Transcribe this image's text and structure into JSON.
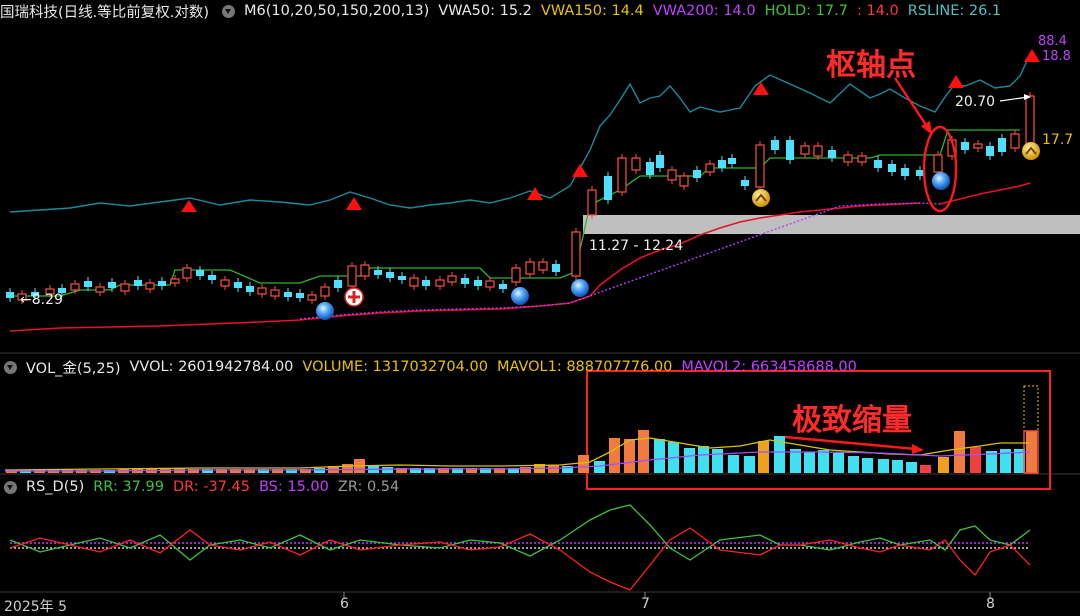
{
  "header": {
    "title": "国瑞科技(日线.等比前复权.对数)",
    "ma_label": "M6(10,20,50,150,200,13)",
    "vwa50": "VWA50: 15.2",
    "vwa150": "VWA150: 14.4",
    "vwa200": "VWA200: 14.0",
    "hold": "HOLD: 17.7",
    "hold_extra": ": 14.0",
    "rsline": "RSLINE: 26.1"
  },
  "price_panel": {
    "price_low_label": "←8.29",
    "range_label": "11.27 - 12.24",
    "high_label": "20.70",
    "hold_right": "17.7",
    "rs_right_top": "88.4",
    "rs_right_bottom": "18.8",
    "annotation_pivot": "枢轴点"
  },
  "volume_panel": {
    "name": "VOL_金(5,25)",
    "vvol": "VVOL: 2601942784.00",
    "volume": "VOLUME: 1317032704.00",
    "mavol1": "MAVOL1: 888707776.00",
    "mavol2": "MAVOL2: 663458688.00",
    "annotation_shrink": "极致缩量"
  },
  "rs_panel": {
    "name": "RS_D(5)",
    "rr": "RR: 37.99",
    "dr": "DR: -37.45",
    "bs": "BS: 15.00",
    "zr": "ZR: 0.54"
  },
  "x_axis": {
    "labels": [
      "2025年 5",
      "6",
      "7",
      "8"
    ]
  },
  "colors": {
    "up": "#ff5040",
    "down": "#50e0ff",
    "rsline": "#1a8a9a",
    "hold_line": "#2fb52f",
    "ma_red": "#e8102a",
    "ma_purple": "#b040ff",
    "volume_ma1": "#d8c400",
    "volume_ma2": "#a050ff",
    "annotation": "#ff2020"
  }
}
